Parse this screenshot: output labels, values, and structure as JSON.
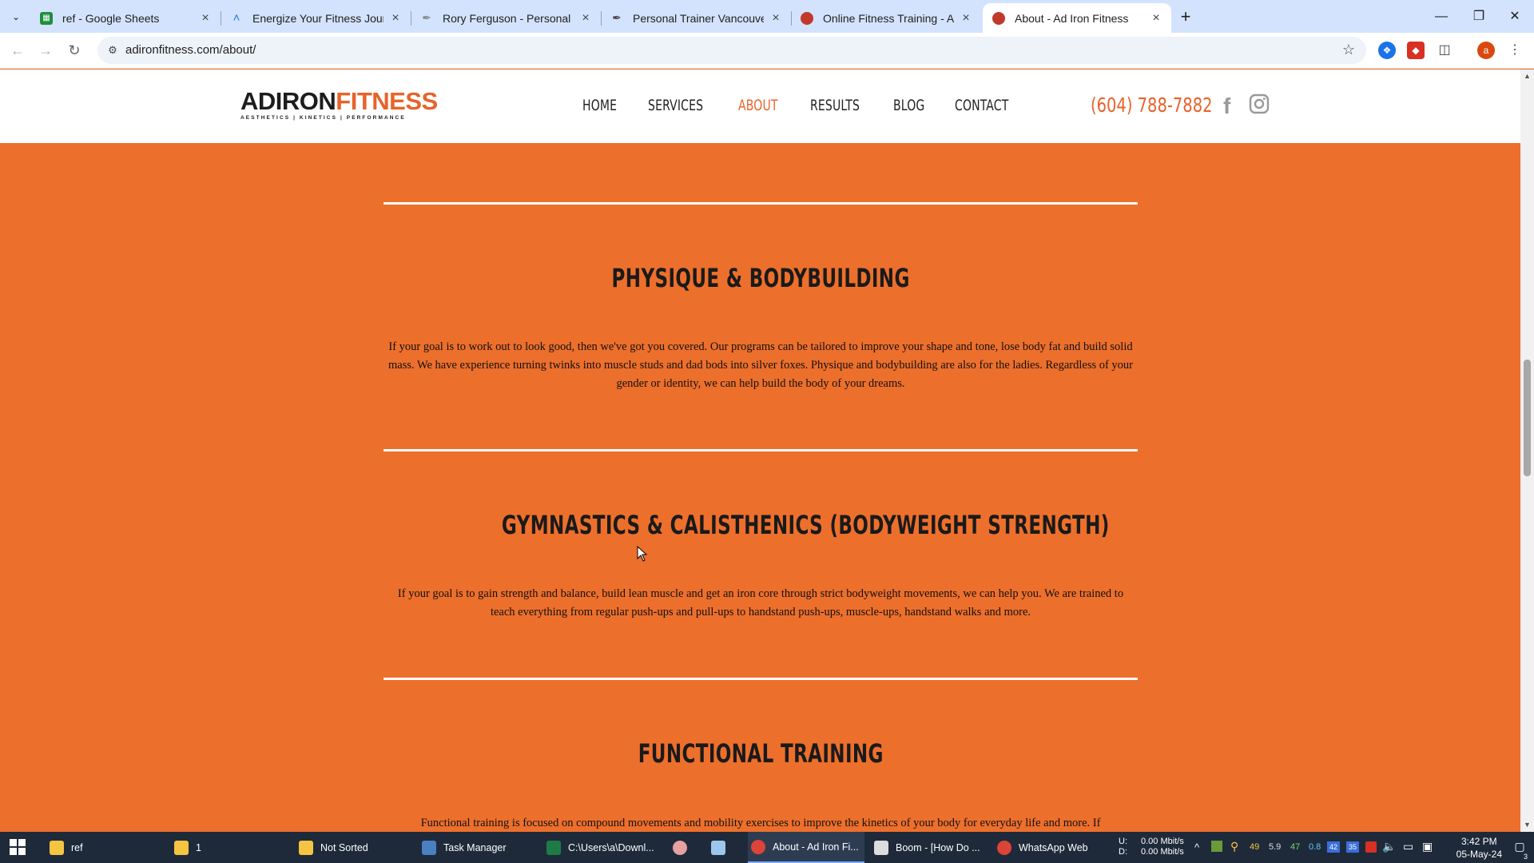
{
  "browser": {
    "tabs": [
      {
        "title": "ref - Google Sheets",
        "favicon": "sheets-icon",
        "color": "#1e8e3e"
      },
      {
        "title": "Energize Your Fitness Journey w",
        "favicon": "chevron-up-icon",
        "color": "#1a73e8"
      },
      {
        "title": "Rory Ferguson - Personal Traini",
        "favicon": "pen-icon",
        "color": "#888888"
      },
      {
        "title": "Personal Trainer Vancouver | Wo",
        "favicon": "pen-icon",
        "color": "#444444"
      },
      {
        "title": "Online Fitness Training - Ad Iron",
        "favicon": "globe-icon",
        "color": "#c0392b"
      },
      {
        "title": "About - Ad Iron Fitness",
        "favicon": "globe-icon",
        "color": "#c0392b"
      }
    ],
    "active_tab": 5,
    "url": "adironfitness.com/about/",
    "profile_initial": "a"
  },
  "site": {
    "logo": {
      "part1": "ADIRON",
      "part2": "FITNESS",
      "tagline": "AESTHETICS | KINETICS | PERFORMANCE"
    },
    "nav": [
      "HOME",
      "SERVICES",
      "ABOUT",
      "RESULTS",
      "BLOG",
      "CONTACT"
    ],
    "active_nav": "ABOUT",
    "phone": "(604) 788-7882",
    "accent": "#e8632a",
    "background": "#ed6f2c"
  },
  "sections": [
    {
      "title": "PHYSIQUE & BODYBUILDING",
      "body": "If your goal is to work out to look good, then we've got you covered. Our programs can be tailored to improve your shape and tone, lose body fat and build solid mass. We have experience turning twinks into muscle studs and dad bods into silver foxes. Physique and bodybuilding are also for the ladies. Regardless of your gender or identity, we can help build the body of your dreams."
    },
    {
      "title": "GYMNASTICS & CALISTHENICS (BODYWEIGHT STRENGTH)",
      "body": "If your goal is to gain strength and balance, build lean muscle and get an iron core through strict bodyweight movements, we can help you. We are trained to teach everything from regular push-ups and pull-ups to handstand push-ups, muscle-ups, handstand walks and more."
    },
    {
      "title": "FUNCTIONAL TRAINING",
      "body": "Functional training is focused on compound movements and mobility exercises to improve the kinetics of your body for everyday life and more. If"
    }
  ],
  "taskbar": {
    "items": [
      {
        "label": "ref",
        "icon": "folder-icon"
      },
      {
        "label": "1",
        "icon": "folder-icon"
      },
      {
        "label": "Not Sorted",
        "icon": "folder-icon"
      },
      {
        "label": "Task Manager",
        "icon": "task-manager-icon"
      },
      {
        "label": "C:\\Users\\a\\Downl...",
        "icon": "excel-icon"
      },
      {
        "label": "",
        "icon": "app-icon"
      },
      {
        "label": "",
        "icon": "notepad-icon"
      },
      {
        "label": "About - Ad Iron Fi...",
        "icon": "chrome-icon"
      },
      {
        "label": "Boom - [How Do ...",
        "icon": "boom-icon"
      },
      {
        "label": "WhatsApp Web",
        "icon": "chrome-icon"
      }
    ],
    "net_up_label": "U:",
    "net_down_label": "D:",
    "net_up": "0.00 Mbit/s",
    "net_down": "0.00 Mbit/s",
    "tray_numbers": [
      "49",
      "5.9",
      "47",
      "0.8"
    ],
    "tray_badges": [
      "42",
      "35"
    ],
    "time": "3:42 PM",
    "date": "05-May-24",
    "notifications": "3"
  }
}
